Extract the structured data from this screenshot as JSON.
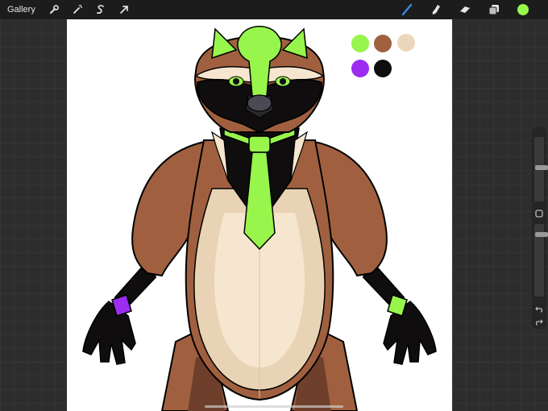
{
  "app": {
    "gallery_label": "Gallery",
    "left_tools": [
      "wrench-icon",
      "magic-wand-icon",
      "selection-icon",
      "transform-icon"
    ],
    "right_tools": [
      "brush-icon",
      "smudge-icon",
      "eraser-icon",
      "layers-icon"
    ],
    "active_tool": "brush",
    "current_color": "#97f54c"
  },
  "palette": {
    "swatches": [
      "#97f54c",
      "#a0603f",
      "#ecd7bc",
      "#9b2cf0",
      "#0f0d0d"
    ]
  },
  "sidebar": {
    "brush_size_level": 0.15,
    "opacity_level": 0.45
  },
  "colors": {
    "fur_brown": "#a0603f",
    "fur_shadow": "#6e3f2a",
    "cream": "#f6e6cf",
    "cream_shadow": "#e9d3b5",
    "mask": "#0f0d0d",
    "green": "#97f54c",
    "purple": "#9b2cf0"
  }
}
